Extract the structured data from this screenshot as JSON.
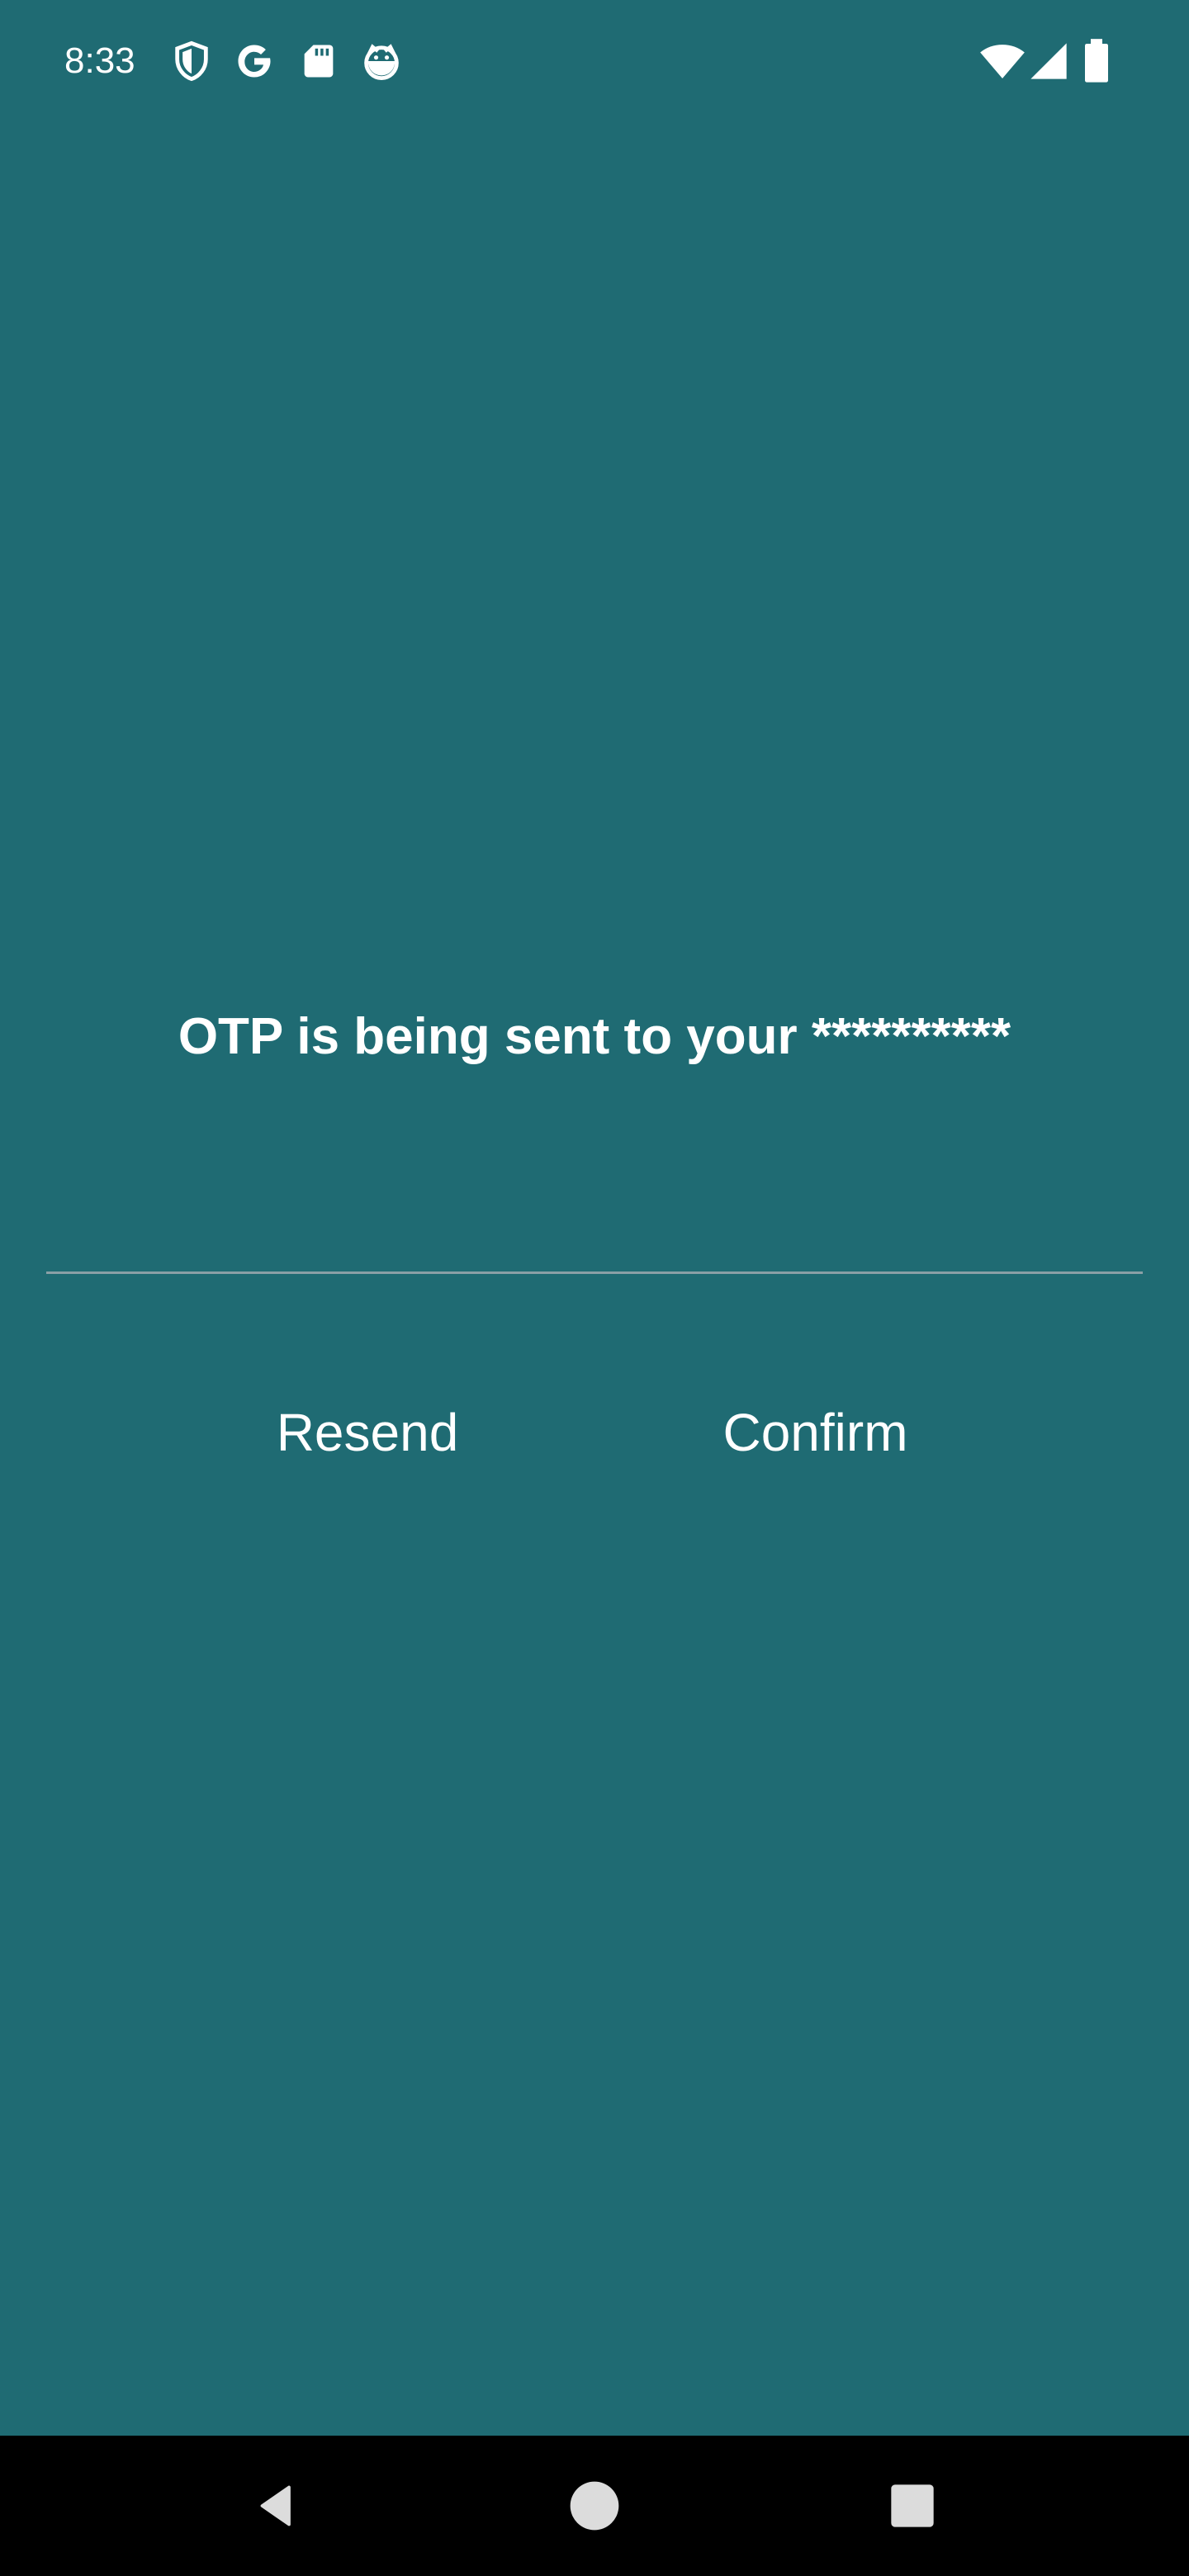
{
  "status_bar": {
    "time": "8:33",
    "left_icons": [
      "shield-icon",
      "google-icon",
      "sd-card-icon",
      "face-icon"
    ],
    "right_icons": [
      "wifi-icon",
      "cellular-signal-icon",
      "battery-icon"
    ]
  },
  "main": {
    "message": "OTP is being sent to your **********",
    "otp_input": {
      "value": "",
      "placeholder": ""
    },
    "resend_label": "Resend",
    "confirm_label": "Confirm"
  },
  "nav_bar": {
    "buttons": [
      "back-icon",
      "home-icon",
      "recents-icon"
    ]
  },
  "colors": {
    "background": "#1f6b73",
    "text": "#ffffff",
    "input_underline": "#8aa0a6",
    "nav_bar": "#000000"
  }
}
